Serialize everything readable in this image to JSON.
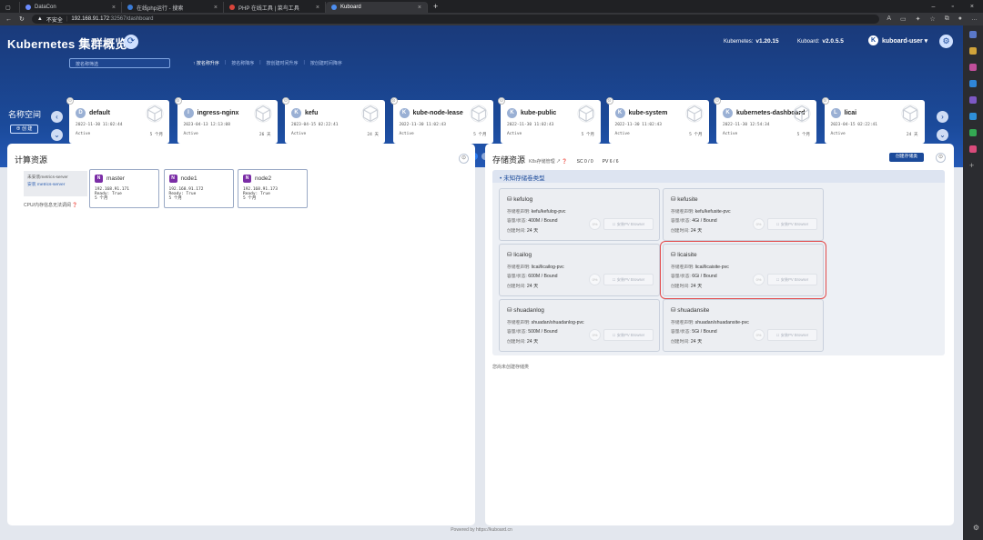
{
  "browser": {
    "tabs": [
      {
        "label": "DataCon",
        "active": false,
        "color": "#6b8cff"
      },
      {
        "label": "在线php运行 - 搜索",
        "active": false,
        "color": "#3a7bd5"
      },
      {
        "label": "PHP 在线工具 | 菜鸟工具",
        "active": false,
        "color": "#d9453b"
      },
      {
        "label": "Kuboard",
        "active": true,
        "color": "#4d8ef0"
      }
    ],
    "new_tab": "+",
    "insecure_label": "不安全",
    "url_host": "192.168.91.172",
    "url_rest": ":32567/dashboard"
  },
  "header": {
    "title": "Kubernetes 集群概览",
    "kubernetes_label": "Kubernetes:",
    "kubernetes_version": "v1.20.15",
    "kuboard_label": "Kuboard:",
    "kuboard_version": "v2.0.5.5",
    "user_initial": "K",
    "user_name": "kuboard-user ▾"
  },
  "namespace_bar": {
    "filter_placeholder": "按名称筛选",
    "sorts": [
      "↑ 按名称升序",
      "按名称降序",
      "按创建时间升序",
      "按创建时间降序"
    ],
    "label": "名称空间",
    "create_button": "⊕ 创 建",
    "cards": [
      {
        "initial": "D",
        "name": "default",
        "date": "2022-11-30 11:02:44",
        "status": "Active",
        "age": "5 个月"
      },
      {
        "initial": "I",
        "name": "ingress-nginx",
        "date": "2023-04-13 12:13:08",
        "status": "Active",
        "age": "26 天"
      },
      {
        "initial": "K",
        "name": "kefu",
        "date": "2023-04-15 02:22:41",
        "status": "Active",
        "age": "24 天"
      },
      {
        "initial": "K",
        "name": "kube-node-lease",
        "date": "2022-11-30 11:02:43",
        "status": "Active",
        "age": "5 个月"
      },
      {
        "initial": "K",
        "name": "kube-public",
        "date": "2022-11-30 11:02:43",
        "status": "Active",
        "age": "5 个月"
      },
      {
        "initial": "K",
        "name": "kube-system",
        "date": "2022-11-30 11:02:43",
        "status": "Active",
        "age": "5 个月"
      },
      {
        "initial": "K",
        "name": "kubernetes-dashboard",
        "date": "2022-11-30 12:54:34",
        "status": "Active",
        "age": "5 个月"
      },
      {
        "initial": "L",
        "name": "licai",
        "date": "2023-04-15 02:22:41",
        "status": "Active",
        "age": "24 天"
      }
    ],
    "pages": [
      "1",
      ""
    ]
  },
  "compute": {
    "title": "计算资源",
    "ms_line1": "未安装metrics-server",
    "ms_line2": "安装 metrics-server",
    "cpu_note": "CPU/内存信息无法调阅 ❓",
    "nodes": [
      {
        "name": "master",
        "ip": "192.168.91.171",
        "ready": "Ready: True",
        "age": "5 个月"
      },
      {
        "name": "node1",
        "ip": "192.168.91.172",
        "ready": "Ready: True",
        "age": "5 个月"
      },
      {
        "name": "node2",
        "ip": "192.168.91.173",
        "ready": "Ready: True",
        "age": "5 个月"
      }
    ]
  },
  "storage": {
    "title": "存储资源",
    "subtitle": "K8s存储管理 ↗ ❓",
    "sc_count": "SC 0 / 0",
    "pv_count": "PV 6 / 6",
    "create_button": "创建存储类",
    "section_title": "• 未知存储卷类型",
    "claim_label": "存储卷声明:",
    "capacity_label": "容量/状态:",
    "created_label": "创建时间:",
    "pv_browser": "☐ 安装PV Browser",
    "pct": "0%",
    "pvcs": [
      {
        "name": "kefulog",
        "claim": "kefu/kefulog-pvc",
        "capacity": "400M / Bound",
        "age": "24 天"
      },
      {
        "name": "kefusite",
        "claim": "kefu/kefusite-pvc",
        "capacity": "4Gi / Bound",
        "age": "24 天"
      },
      {
        "name": "licailog",
        "claim": "licai/licailog-pvc",
        "capacity": "600M / Bound",
        "age": "24 天"
      },
      {
        "name": "licaisite",
        "claim": "licai/licaisite-pvc",
        "capacity": "6Gi / Bound",
        "age": "24 天"
      },
      {
        "name": "shuadanlog",
        "claim": "shuadan/shuadanlog-pvc",
        "capacity": "500M / Bound",
        "age": "24 天"
      },
      {
        "name": "shuadansite",
        "claim": "shuadan/shuadansite-pvc",
        "capacity": "5Gi / Bound",
        "age": "24 天"
      }
    ],
    "unused_note": "您尚未创建存储类"
  },
  "footer": "Powered by https://kuboard.cn"
}
